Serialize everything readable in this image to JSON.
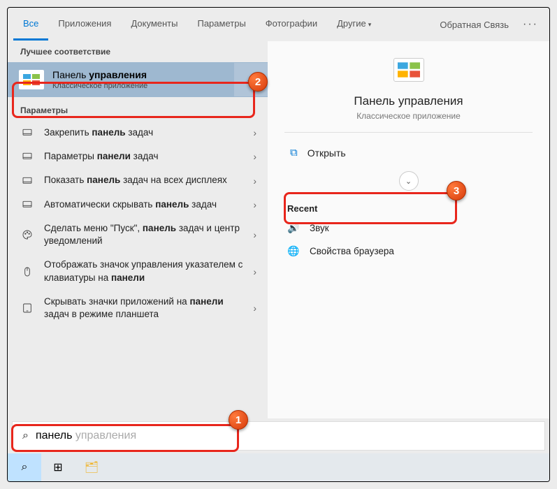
{
  "tabs": {
    "all": "Все",
    "apps": "Приложения",
    "docs": "Документы",
    "params": "Параметры",
    "photos": "Фотографии",
    "other": "Другие",
    "feedback": "Обратная Связь"
  },
  "left": {
    "best_header": "Лучшее соответствие",
    "best_match": {
      "title_pre": "Панель ",
      "title_bold": "управления",
      "subtitle": "Классическое приложение"
    },
    "params_header": "Параметры",
    "items": [
      {
        "pre": "Закрепить ",
        "bold": "панель",
        "post": " задач"
      },
      {
        "pre": "Параметры ",
        "bold": "панели",
        "post": " задач"
      },
      {
        "pre": "Показать ",
        "bold": "панель",
        "post": " задач на всех дисплеях"
      },
      {
        "pre": "Автоматически скрывать ",
        "bold": "панель",
        "post": " задач"
      },
      {
        "pre": "Сделать меню \"Пуск\", ",
        "bold": "панель",
        "post": " задач и центр уведомлений"
      },
      {
        "pre": "Отображать значок управления указателем с клавиатуры на ",
        "bold": "панели",
        "post": ""
      },
      {
        "pre": "Скрывать значки приложений на ",
        "bold": "панели",
        "post": " задач в режиме планшета"
      }
    ]
  },
  "right": {
    "title": "Панель управления",
    "subtitle": "Классическое приложение",
    "open": "Открыть",
    "recent_header": "Recent",
    "recent": [
      {
        "icon": "sound",
        "label": "Звук"
      },
      {
        "icon": "browser",
        "label": "Свойства браузера"
      }
    ]
  },
  "search": {
    "typed": "панель",
    "ghost": " управления"
  },
  "annotations": {
    "b1": "1",
    "b2": "2",
    "b3": "3"
  }
}
